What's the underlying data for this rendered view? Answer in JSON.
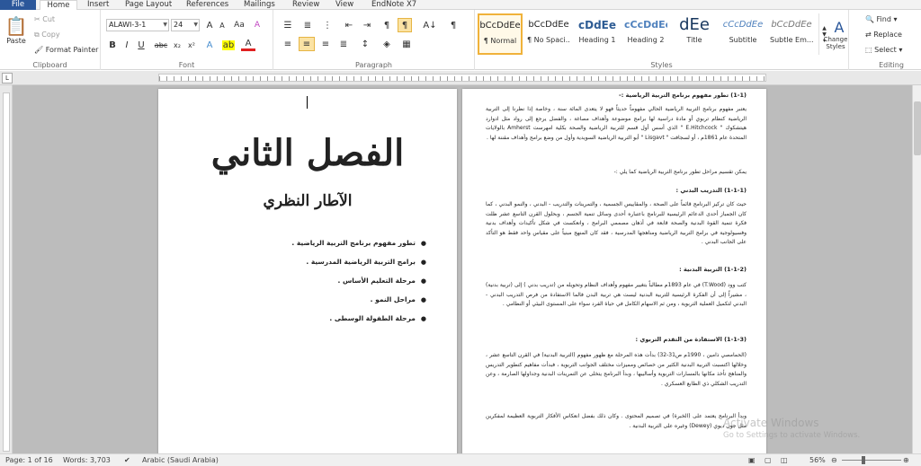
{
  "tabs": [
    "File",
    "Home",
    "Insert",
    "Page Layout",
    "References",
    "Mailings",
    "Review",
    "View",
    "EndNote X7"
  ],
  "clipboard": {
    "paste": "Paste",
    "cut": "Cut",
    "copy": "Copy",
    "format_painter": "Format Painter",
    "label": "Clipboard"
  },
  "font": {
    "name": "ALAWI-3-1",
    "size": "24",
    "label": "Font"
  },
  "paragraph": {
    "label": "Paragraph"
  },
  "styles": {
    "label": "Styles",
    "items": [
      {
        "preview": "bCcDdEe",
        "name": "¶ Normal"
      },
      {
        "preview": "bCcDdEe",
        "name": "¶ No Spaci..."
      },
      {
        "preview": "cDdEe",
        "name": "Heading 1"
      },
      {
        "preview": "cCcDdEe",
        "name": "Heading 2"
      },
      {
        "preview": "dEe",
        "name": "Title"
      },
      {
        "preview": "cCcDdEe",
        "name": "Subtitle"
      },
      {
        "preview": "bCcDdEe",
        "name": "Subtle Em..."
      }
    ],
    "change_styles": "Change Styles"
  },
  "editing": {
    "find": "Find",
    "replace": "Replace",
    "select": "Select",
    "label": "Editing"
  },
  "page_left": {
    "title": "الفصل الثاني",
    "subtitle": "الآطار النظري",
    "toc": [
      "تطور مفهوم برنامج التربية الرياضية .",
      "برامج التربية الرياضية المدرسية .",
      "مرحلة التعليم الأساس .",
      "مراحل النمو .",
      "مرحلة الطفولة الوسطى ."
    ]
  },
  "page_right": {
    "heading1": "(1-1) تطور مفهوم برنامج التربية الرياضية :-",
    "p1": "يعتبر مفهوم برنامج التربية الرياضية الحالي مفهوماً حديثاً فهو لا يتعدى المائة سنة ، وخاصة إذا نظرنا إلى التربية الرياضية كنظام تربوي أو مادة دراسية لها برامج موضوعة وأهداف مصاغة ، والفضل يرجع إلى رواد مثل ادوارد هيتشكوك \" E.Hitchcock \" الذي أسس أول قسم للتربية الرياضية والصحة بكلية امهرست Amherst بالولايات المتحدة عام 1861م ، أو لسجافت \" Lisgavt \" أبو التربية الرياضية السويدية وأول من وضع برامج وأهداف مقننة لها .",
    "p2": "يمكن تقسيم مراحل تطور برنامج التربية الرياضية كما يلي :-",
    "h2": "(1-1-1) التدريب البدني :",
    "p3": "حيث كان تركيز البرنامج قائماً على الصحة ، والمقاييس الجسمية ، والتمرينات والتدريب - البدني ، والنمو البدني ، كما كان الجمباز أحدى الدعائم الرئيسية للبرنامج باعتباره أحدى وسائل تنمية الجسم ، وبحلول القرن التاسع عشر ظلت فكرة تنمية القوة البدنية والصحة قابعة في أذهان مصممي البرامج ، وانعكست في شكل تأكيدات وأهداف بدنية وفسيولوجية في برامج التربية الرياضية ومناهجها المدرسية ، فقد كان المنهج مبنياً على مقياس واحد فقط هو التأكد على الجانب البدني .",
    "h3": "(1-1-2) التربية البدنية :",
    "p4": "كتب وود (T.Wood) في عام 1893م مطالباً بتغيير مفهوم وأهداف النظام وتحويله من (تدريب بدني ) إلى (تربية بدنية) ، مشيراً إلى أن الفكرة الرئيسية للتربية البدنية ليست هي تربية البدن فالما الاستفادة من فرص التدريب البدني - البدني لتكميل العملية التربوية ، ومن ثم الاسهام الكامل في حياة الفرد سواء على المستوى البيئي أو النظامي .",
    "h4": "(1-1-3) الاستفادة من التقدم التربوي :",
    "p5": "(الحمامصي ذامين ، 1990م ص31-32) بدأت هذه المرحلة مع ظهور مفهوم (التربية البدنية) في القرن التاسع عشر ، وخلالها اكتسبت التربية البدنية الكثير من خصائص ومميزات مختلف الجوانب التربوية ، فبدأت مفاهيم كتطوير التدريس والمناهج تأخذ مكانها بالمسارات التربوية وأساليبها ، وبدأ البرنامج يتخلى عن التمرينات البدنية وجداولها الصارمة ، وعن التدريب الشكلي ذي الطابع العسكري .",
    "p6": "وبدأ البرنامج يعتمد على (الخبرة) في تصميم المحتوى . وكان ذلك بفضل انعكاس الأفكار التربوية العظيمة لمفكرين مثل جون ديوي (Dewey) وغيره على التربية البدنية ."
  },
  "status": {
    "page": "Page: 1 of 16",
    "words": "Words: 3,703",
    "language": "Arabic (Saudi Arabia)",
    "zoom": "56%"
  },
  "watermark": {
    "line1": "Activate Windows",
    "line2": "Go to Settings to activate Windows."
  }
}
